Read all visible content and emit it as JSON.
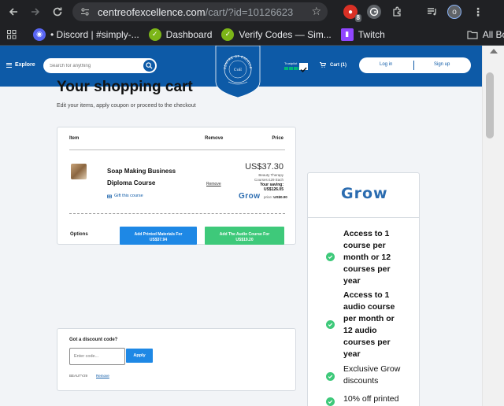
{
  "browser": {
    "url_host": "centreofexcellence.com",
    "url_path": "/cart/?id=10126623",
    "extension_badge": "8",
    "profile_initial": "o",
    "bookmarks": [
      {
        "label": "• Discord | #simply-...",
        "icon_color": "#5865f2"
      },
      {
        "label": "Dashboard",
        "icon_color": "#7cb518"
      },
      {
        "label": "Verify Codes — Sim...",
        "icon_color": "#7cb518"
      },
      {
        "label": "Twitch",
        "icon_color": "#9146ff"
      }
    ],
    "all_bookmarks": "All Bookmarks"
  },
  "header": {
    "explore": "Explore",
    "search_placeholder": "Search for anything",
    "logo_text": "CENTRE OF EXCELLENCE",
    "logo_initials": "CoE",
    "trustpilot_label": "Trustpilot",
    "cart_label": "Cart (1)",
    "login": "Log in",
    "signup": "Sign up",
    "brand_color": "#0d5aa7"
  },
  "main": {
    "title": "Your shopping cart",
    "subtitle": "Edit your items, apply coupon or proceed to the checkout"
  },
  "cart": {
    "columns": {
      "item": "Item",
      "remove": "Remove",
      "price": "Price"
    },
    "item": {
      "title_line1": "Soap Making Business",
      "title_line2": "Diploma Course",
      "gift": "Gift this course",
      "remove": "Remove",
      "price": "US$37.30",
      "price_note_line1": "Beauty Therapy",
      "price_note_line2": "Courses £29 Each",
      "saving_line1": "Your saving:",
      "saving_line2": "US$126.05",
      "grow_label": "Grow",
      "grow_price_label": "price:",
      "grow_price": "US$0.00"
    },
    "options_label": "Options",
    "printed_btn_line1": "Add Printed Materials For",
    "printed_btn_line2": "US$37.94",
    "audio_btn_line1": "Add The Audio Course For",
    "audio_btn_line2": "US$19.20"
  },
  "discount": {
    "title": "Got a discount code?",
    "placeholder": "Enter code...",
    "apply": "Apply",
    "applied_code": "BEAUTY29",
    "remove": "Remove"
  },
  "grow": {
    "logo": "Grow",
    "benefits": [
      {
        "lines": [
          "Access to 1",
          "course per",
          "month or 12",
          "courses per",
          "year"
        ],
        "bold": true
      },
      {
        "lines": [
          "Access to 1",
          "audio course",
          "per month or",
          "12 audio",
          "courses per",
          "year"
        ],
        "bold": true
      },
      {
        "lines": [
          "Exclusive Grow",
          "discounts"
        ],
        "bold": false
      },
      {
        "lines": [
          "10% off printed"
        ],
        "bold": false
      }
    ]
  }
}
